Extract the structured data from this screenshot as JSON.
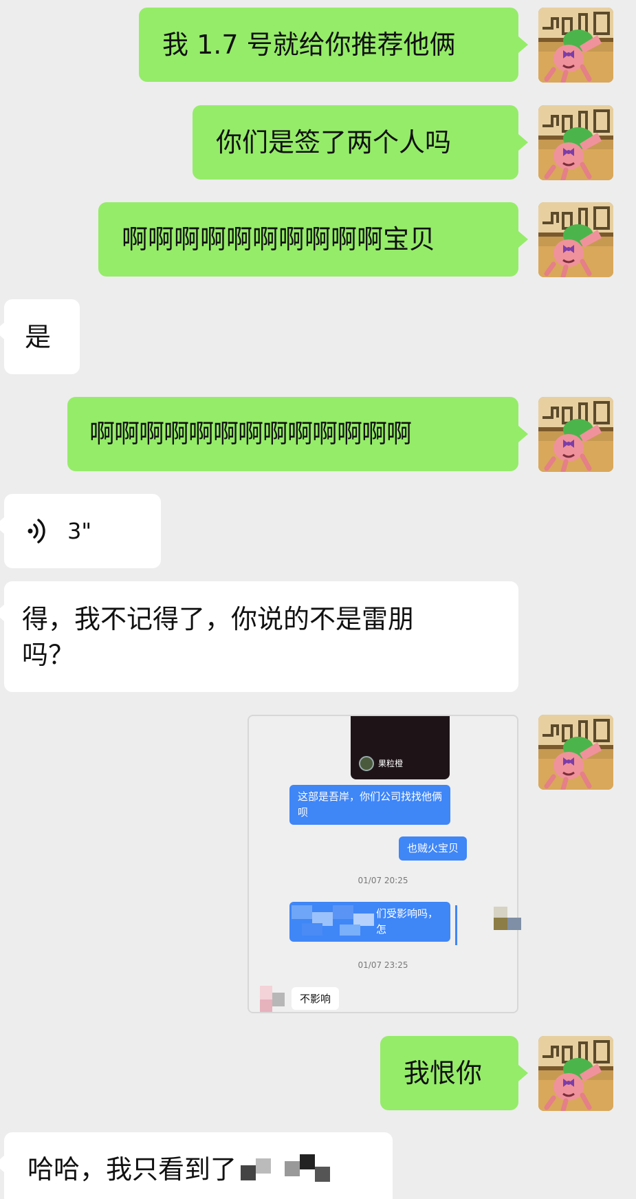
{
  "messages": {
    "m1": "我 1.7 号就给你推荐他俩",
    "m2": "你们是签了两个人吗",
    "m3": "啊啊啊啊啊啊啊啊啊啊宝贝",
    "m4": "是",
    "m5": "啊啊啊啊啊啊啊啊啊啊啊啊啊",
    "m6_duration": "3\"",
    "m7_line1": "得，我不记得了，你说的不是雷朋",
    "m7_line2": "吗？",
    "m9": "我恨你",
    "m10": "哈哈，我只看到了"
  },
  "screenshot": {
    "video_name": "果粒橙",
    "bubble1": "这部是吾岸，你们公司找找他俩呗",
    "bubble2": "也贼火宝贝",
    "time1": "01/07 20:25",
    "bubble3": "们受影响吗，怎",
    "time2": "01/07 23:25",
    "reply": "不影响"
  },
  "colors": {
    "background": "#ededed",
    "my_bubble": "#95ec69",
    "their_bubble": "#ffffff",
    "screenshot_bubble": "#3f86f7"
  },
  "icons": {
    "avatar": "cartoon-avatar-icon",
    "voice": "voice-wave-icon"
  }
}
